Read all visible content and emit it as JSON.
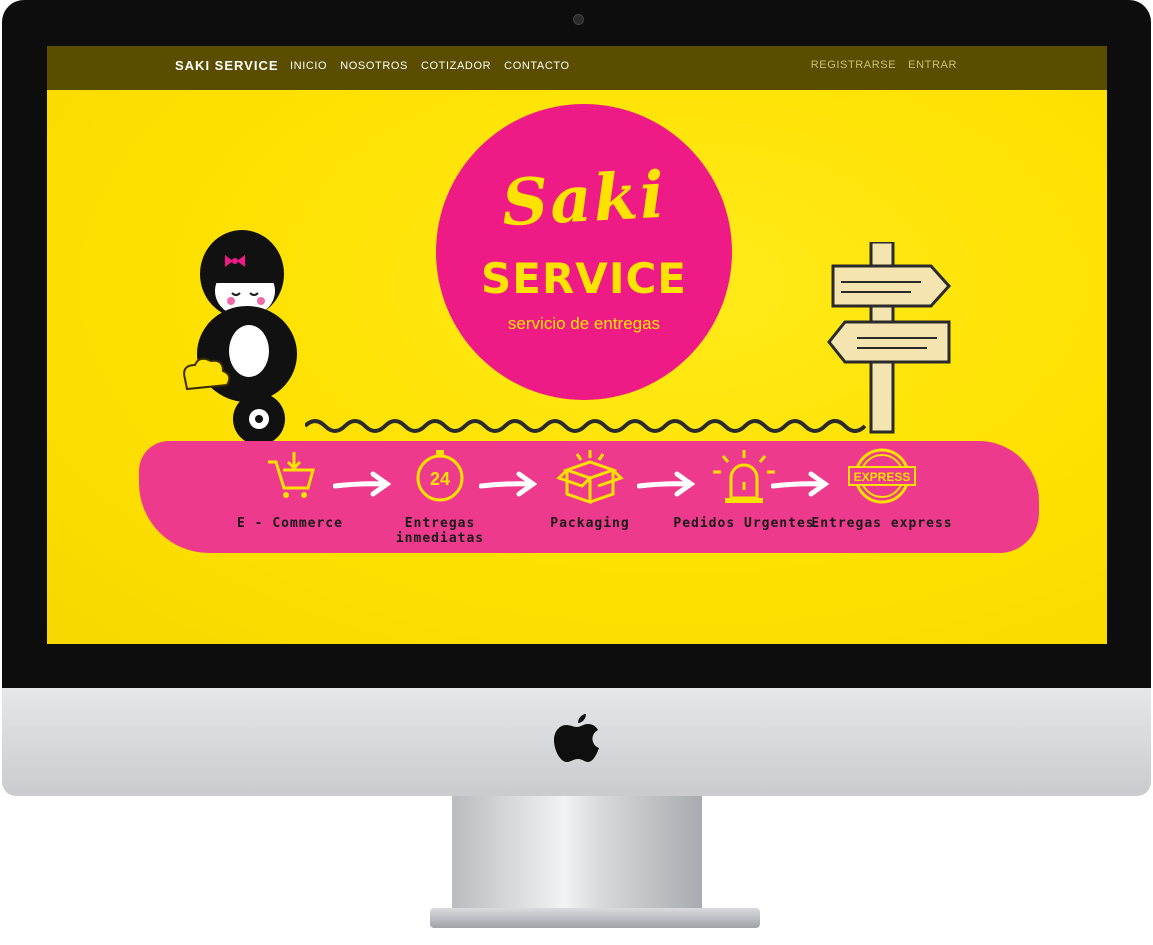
{
  "brand": "SAKI SERVICE",
  "nav": [
    "INICIO",
    "NOSOTROS",
    "COTIZADOR",
    "CONTACTO"
  ],
  "auth": {
    "register": "REGISTRARSE",
    "login": "ENTRAR"
  },
  "hero": {
    "logo_script": "Saki",
    "logo_title": "SERVICE",
    "logo_subtitle": "servicio de entregas"
  },
  "steps": [
    {
      "label": "E - Commerce",
      "icon": "cart-icon"
    },
    {
      "label": "Entregas inmediatas",
      "icon": "timer-24-icon"
    },
    {
      "label": "Packaging",
      "icon": "box-icon"
    },
    {
      "label": "Pedidos Urgentes",
      "icon": "alarm-light-icon"
    },
    {
      "label": "Entregas express",
      "icon": "express-stamp-icon"
    }
  ],
  "stamp_text": "EXPRESS",
  "timer_text": "24",
  "colors": {
    "yellow": "#ffe100",
    "pink": "#ee1a86",
    "navbar": "#5b4d00",
    "band": "#ee3a8c"
  }
}
